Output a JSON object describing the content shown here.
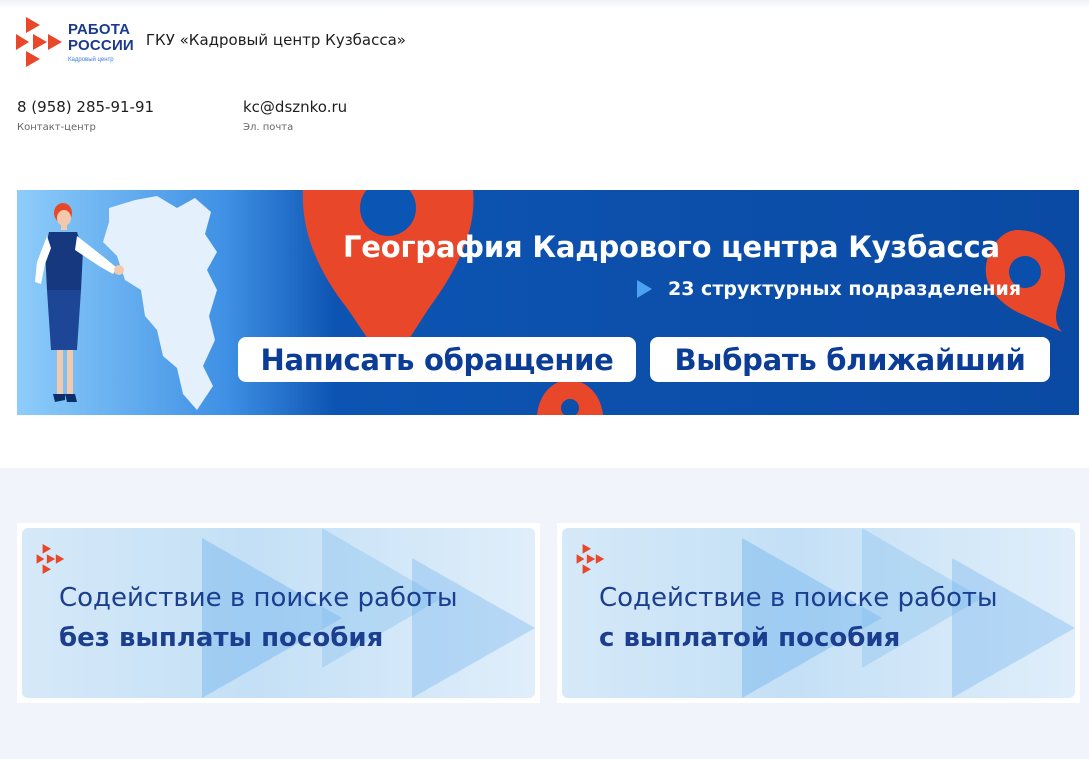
{
  "header": {
    "logo": {
      "line1": "РАБОТА",
      "line2": "РОССИИ",
      "sub": "Кадровый центр"
    },
    "org_name": "ГКУ «Кадровый центр Кузбасса»"
  },
  "contacts": [
    {
      "value": "8 (958) 285-91-91",
      "caption": "Контакт-центр"
    },
    {
      "value": "kc@dsznko.ru",
      "caption": "Эл. почта"
    }
  ],
  "banner": {
    "title": "География Кадрового центра Кузбасса",
    "subtitle": "23 структурных подразделения",
    "button_write": "Написать обращение",
    "button_choose": "Выбрать ближайший"
  },
  "services": [
    {
      "line1": "Содействие в поиске работы",
      "line2": "без выплаты пособия"
    },
    {
      "line1": "Содействие в поиске работы",
      "line2": "с выплатой пособия"
    }
  ],
  "colors": {
    "brand_red": "#e8472a",
    "brand_blue": "#1b3a8c",
    "banner_blue": "#0a4fab",
    "section_bg": "#f2f4fb"
  },
  "icons": [
    "logo-mark-icon",
    "play-icon",
    "card-logo-icon"
  ]
}
